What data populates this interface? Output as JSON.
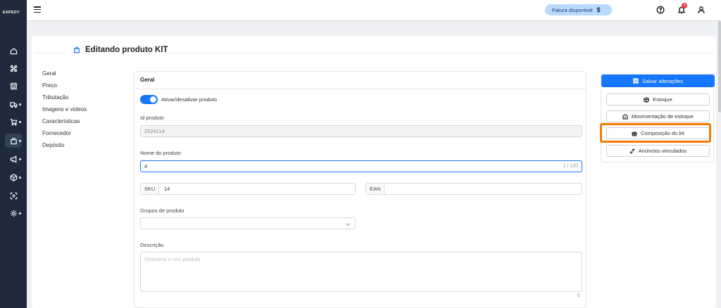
{
  "app": {
    "logo_text": "EXPEDY"
  },
  "rail": {
    "items": [
      {
        "icon": "home-icon"
      },
      {
        "icon": "network-icon"
      },
      {
        "icon": "store-icon"
      },
      {
        "icon": "truck-icon"
      },
      {
        "icon": "cart-icon"
      },
      {
        "icon": "bag-icon"
      },
      {
        "icon": "megaphone-icon"
      },
      {
        "icon": "box-icon"
      },
      {
        "icon": "scan-icon"
      },
      {
        "icon": "gear-icon"
      }
    ]
  },
  "topbar": {
    "fatura_label": "Fatura disponível",
    "fatura_symbol": "$",
    "notification_count": "3"
  },
  "page": {
    "title": "Editando produto KIT"
  },
  "nav": {
    "items": [
      "Geral",
      "Preço",
      "Tributação",
      "Imagens e vídeos",
      "Características",
      "Fornecedor",
      "Depósito"
    ]
  },
  "form": {
    "section_title": "Geral",
    "toggle_label": "Ativar/desativar produto",
    "toggle_on": true,
    "id_label": "Id produto",
    "id_value": "2524114",
    "name_label": "Nome do produto",
    "name_value": "4",
    "name_counter": "1 / 120",
    "sku_label": "SKU",
    "sku_value": "14",
    "ean_label": "EAN",
    "ean_value": "",
    "groups_label": "Grupos de produto",
    "groups_value": "",
    "description_label": "Descrição",
    "description_placeholder": "Descreva o seu produto",
    "description_counter": "0"
  },
  "actions": {
    "save": "Salvar alterações",
    "stock": "Estoque",
    "stock_moves": "Movimentação de estoque",
    "kit_composition": "Composição do kit",
    "linked_ads": "Anúncios vinculados"
  },
  "colors": {
    "primary": "#1677ff",
    "highlight": "#f57c00",
    "rail": "#1e2a3b"
  }
}
